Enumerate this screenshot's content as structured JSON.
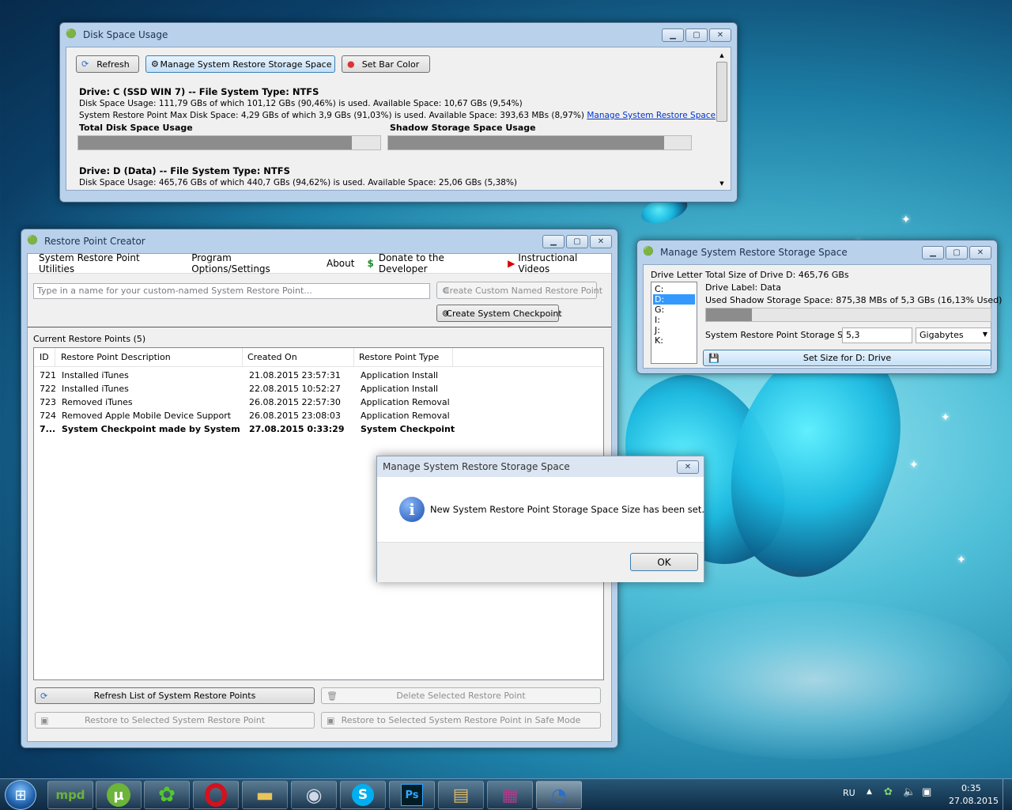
{
  "disk_window": {
    "title": "Disk Space Usage",
    "toolbar": {
      "refresh": "Refresh",
      "manage": "Manage System Restore Storage Space",
      "bar_color": "Set Bar Color"
    },
    "drive_c": {
      "heading": "Drive: C (SSD WIN 7) -- File System Type: NTFS",
      "usage": "Disk Space Usage: 111,79 GBs of which 101,12 GBs (90,46%) is used.  Available Space: 10,67 GBs (9,54%)",
      "restore": "System Restore Point Max Disk Space: 4,29 GBs of which 3,9 GBs (91,03%) is used.  Available Space: 393,63 MBs (8,97%)",
      "manage_link": "Manage System Restore Space",
      "total_label": "Total Disk Space Usage",
      "shadow_label": "Shadow Storage Space Usage",
      "total_pct": 90.46,
      "shadow_pct": 91.03
    },
    "drive_d": {
      "heading": "Drive: D (Data) -- File System Type: NTFS",
      "usage": "Disk Space Usage: 465,76 GBs of which 440,7 GBs (94,62%) is used.  Available Space: 25,06 GBs (5,38%)"
    }
  },
  "rpc_window": {
    "title": "Restore Point Creator",
    "menu": [
      "System Restore Point Utilities",
      "Program Options/Settings",
      "About",
      "Donate to the Developer",
      "Instructional Videos"
    ],
    "name_placeholder": "Type in a name for your custom-named System Restore Point...",
    "create_named": "Create Custom Named Restore Point",
    "create_checkpoint": "Create System Checkpoint",
    "list_label": "Current Restore Points (5)",
    "columns": [
      "ID",
      "Restore Point Description",
      "Created On",
      "Restore Point Type"
    ],
    "rows": [
      {
        "id": "721",
        "desc": "Installed iTunes",
        "created": "21.08.2015 23:57:31",
        "type": "Application Install"
      },
      {
        "id": "722",
        "desc": "Installed iTunes",
        "created": "22.08.2015 10:52:27",
        "type": "Application Install"
      },
      {
        "id": "723",
        "desc": "Removed iTunes",
        "created": "26.08.2015 22:57:30",
        "type": "Application Removal"
      },
      {
        "id": "724",
        "desc": "Removed Apple Mobile Device Support",
        "created": "26.08.2015 23:08:03",
        "type": "Application Removal"
      },
      {
        "id": "7...",
        "desc": "System Checkpoint made by System ...",
        "created": "27.08.2015 0:33:29",
        "type": "System Checkpoint"
      }
    ],
    "refresh_list": "Refresh List of System Restore Points",
    "delete_selected": "Delete Selected Restore Point",
    "restore_selected": "Restore to Selected System Restore Point",
    "restore_safe": "Restore to Selected System Restore Point in Safe Mode"
  },
  "storage_window": {
    "title": "Manage System Restore Storage Space",
    "drive_letter_label": "Drive Letter",
    "drives": [
      "C:",
      "D:",
      "G:",
      "I:",
      "J:",
      "K:"
    ],
    "selected_drive": "D:",
    "total_size": "Total Size of Drive D: 465,76 GBs",
    "drive_label": "Drive Label: Data",
    "used_shadow": "Used Shadow Storage Space: 875,38 MBs of 5,3 GBs (16,13% Used)",
    "used_pct": 16.13,
    "size_label": "System Restore Point Storage Size:",
    "size_value": "5,3",
    "unit": "Gigabytes",
    "set_button": "Set Size for D: Drive"
  },
  "dialog": {
    "title": "Manage System Restore Storage Space",
    "message": "New System Restore Point Storage Space Size has been set.",
    "ok": "OK"
  },
  "taskbar": {
    "lang": "RU",
    "time": "0:35",
    "date": "27.08.2015"
  }
}
